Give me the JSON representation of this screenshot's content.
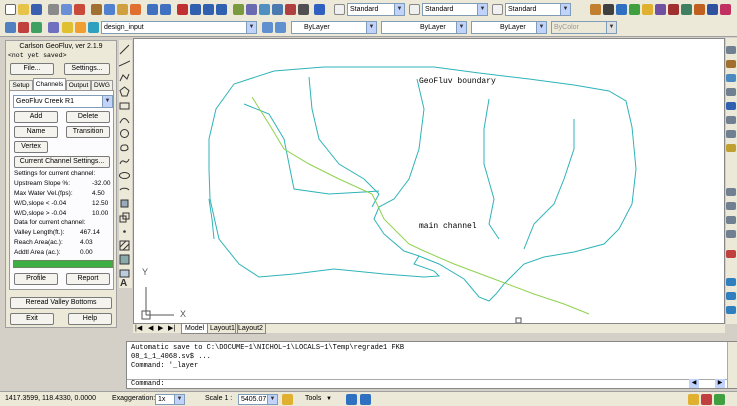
{
  "toolbar": {
    "text_style": "Standard",
    "dim_style": "Standard",
    "table_style": "Standard",
    "layer": "design_input",
    "color": "ByLayer",
    "linetype": "ByLayer",
    "lineweight": "ByLayer",
    "plotstyle": "ByColor"
  },
  "panel": {
    "title": "Carlson GeoFluv, ver 2.1.9",
    "subtitle": "<not yet saved>",
    "file_btn": "File...",
    "settings_btn": "Settings...",
    "tabs": [
      "Setup",
      "Channels",
      "Output",
      "DWG"
    ],
    "creek": "GeoFluv Creek R1",
    "add_btn": "Add",
    "delete_btn": "Delete",
    "name_btn": "Name",
    "transition_btn": "Transition",
    "vertex_btn": "Vertex",
    "current_settings_btn": "Current Channel Settings...",
    "settings_header": "Settings for current channel:",
    "settings": [
      {
        "label": "Upstream Slope %:",
        "value": "-32.00"
      },
      {
        "label": "Max Water Vel.(fps):",
        "value": "4.50"
      },
      {
        "label": "W/D,slope < -0.04",
        "value": "12.50"
      },
      {
        "label": "W/D,slope > -0.04",
        "value": "10.00"
      }
    ],
    "data_header": "Data for current channel:",
    "data": [
      {
        "label": "Valley Length(ft.):",
        "value": "467.14"
      },
      {
        "label": "Reach Area(ac.):",
        "value": "4.03"
      },
      {
        "label": "Addtl Area (ac.):",
        "value": "0.00"
      }
    ],
    "profile_btn": "Profile",
    "report_btn": "Report",
    "reread_btn": "Reread Valley Bottoms",
    "exit_btn": "Exit",
    "help_btn": "Help"
  },
  "drawing": {
    "label_boundary": "GeoFluv boundary",
    "label_channel": "main channel",
    "axis_x": "X",
    "axis_y": "Y",
    "tabs": [
      "Model",
      "Layout1",
      "Layout2"
    ]
  },
  "command": {
    "line1": "Automatic save to C:\\DOCUME~1\\NICHOL~1\\LOCALS~1\\Temp\\regrade1 FKB",
    "line2": "08_1_1_4068.sv$ ...",
    "line3": "Command: '_layer",
    "prompt": "Command:"
  },
  "status": {
    "coords": "1417.3599, 118.4330, 0.0000",
    "exaggeration_label": "Exaggeration:",
    "exaggeration_value": "1x",
    "scale_label": "Scale 1 :",
    "scale_value": "5405.07",
    "tools": "Tools"
  }
}
